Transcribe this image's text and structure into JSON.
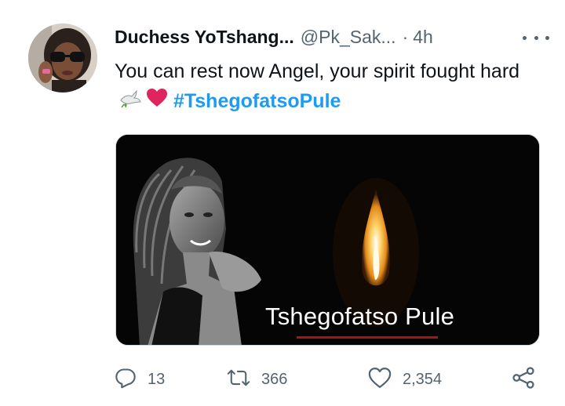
{
  "author": {
    "display_name": "Duchess YoTshang...",
    "handle": "@Pk_Sak...",
    "separator": "·",
    "time": "4h"
  },
  "tweet": {
    "text_main": "You can rest now Angel, your spirit fought hard",
    "emojis": [
      "dove-emoji",
      "red-heart-emoji"
    ],
    "hashtag": "#TshegofatsoPule"
  },
  "media": {
    "caption": "Tshegofatso Pule",
    "icons": [
      "portrait-photo",
      "candle-flame"
    ]
  },
  "actions": {
    "reply_count": "13",
    "retweet_count": "366",
    "like_count": "2,354"
  },
  "icons": {
    "more": "more-icon",
    "reply": "reply-icon",
    "retweet": "retweet-icon",
    "like": "heart-icon",
    "share": "share-icon"
  },
  "colors": {
    "text": "#0f1419",
    "secondary": "#536471",
    "link": "#1d9bf0",
    "heart_emoji": "#e0245e"
  }
}
